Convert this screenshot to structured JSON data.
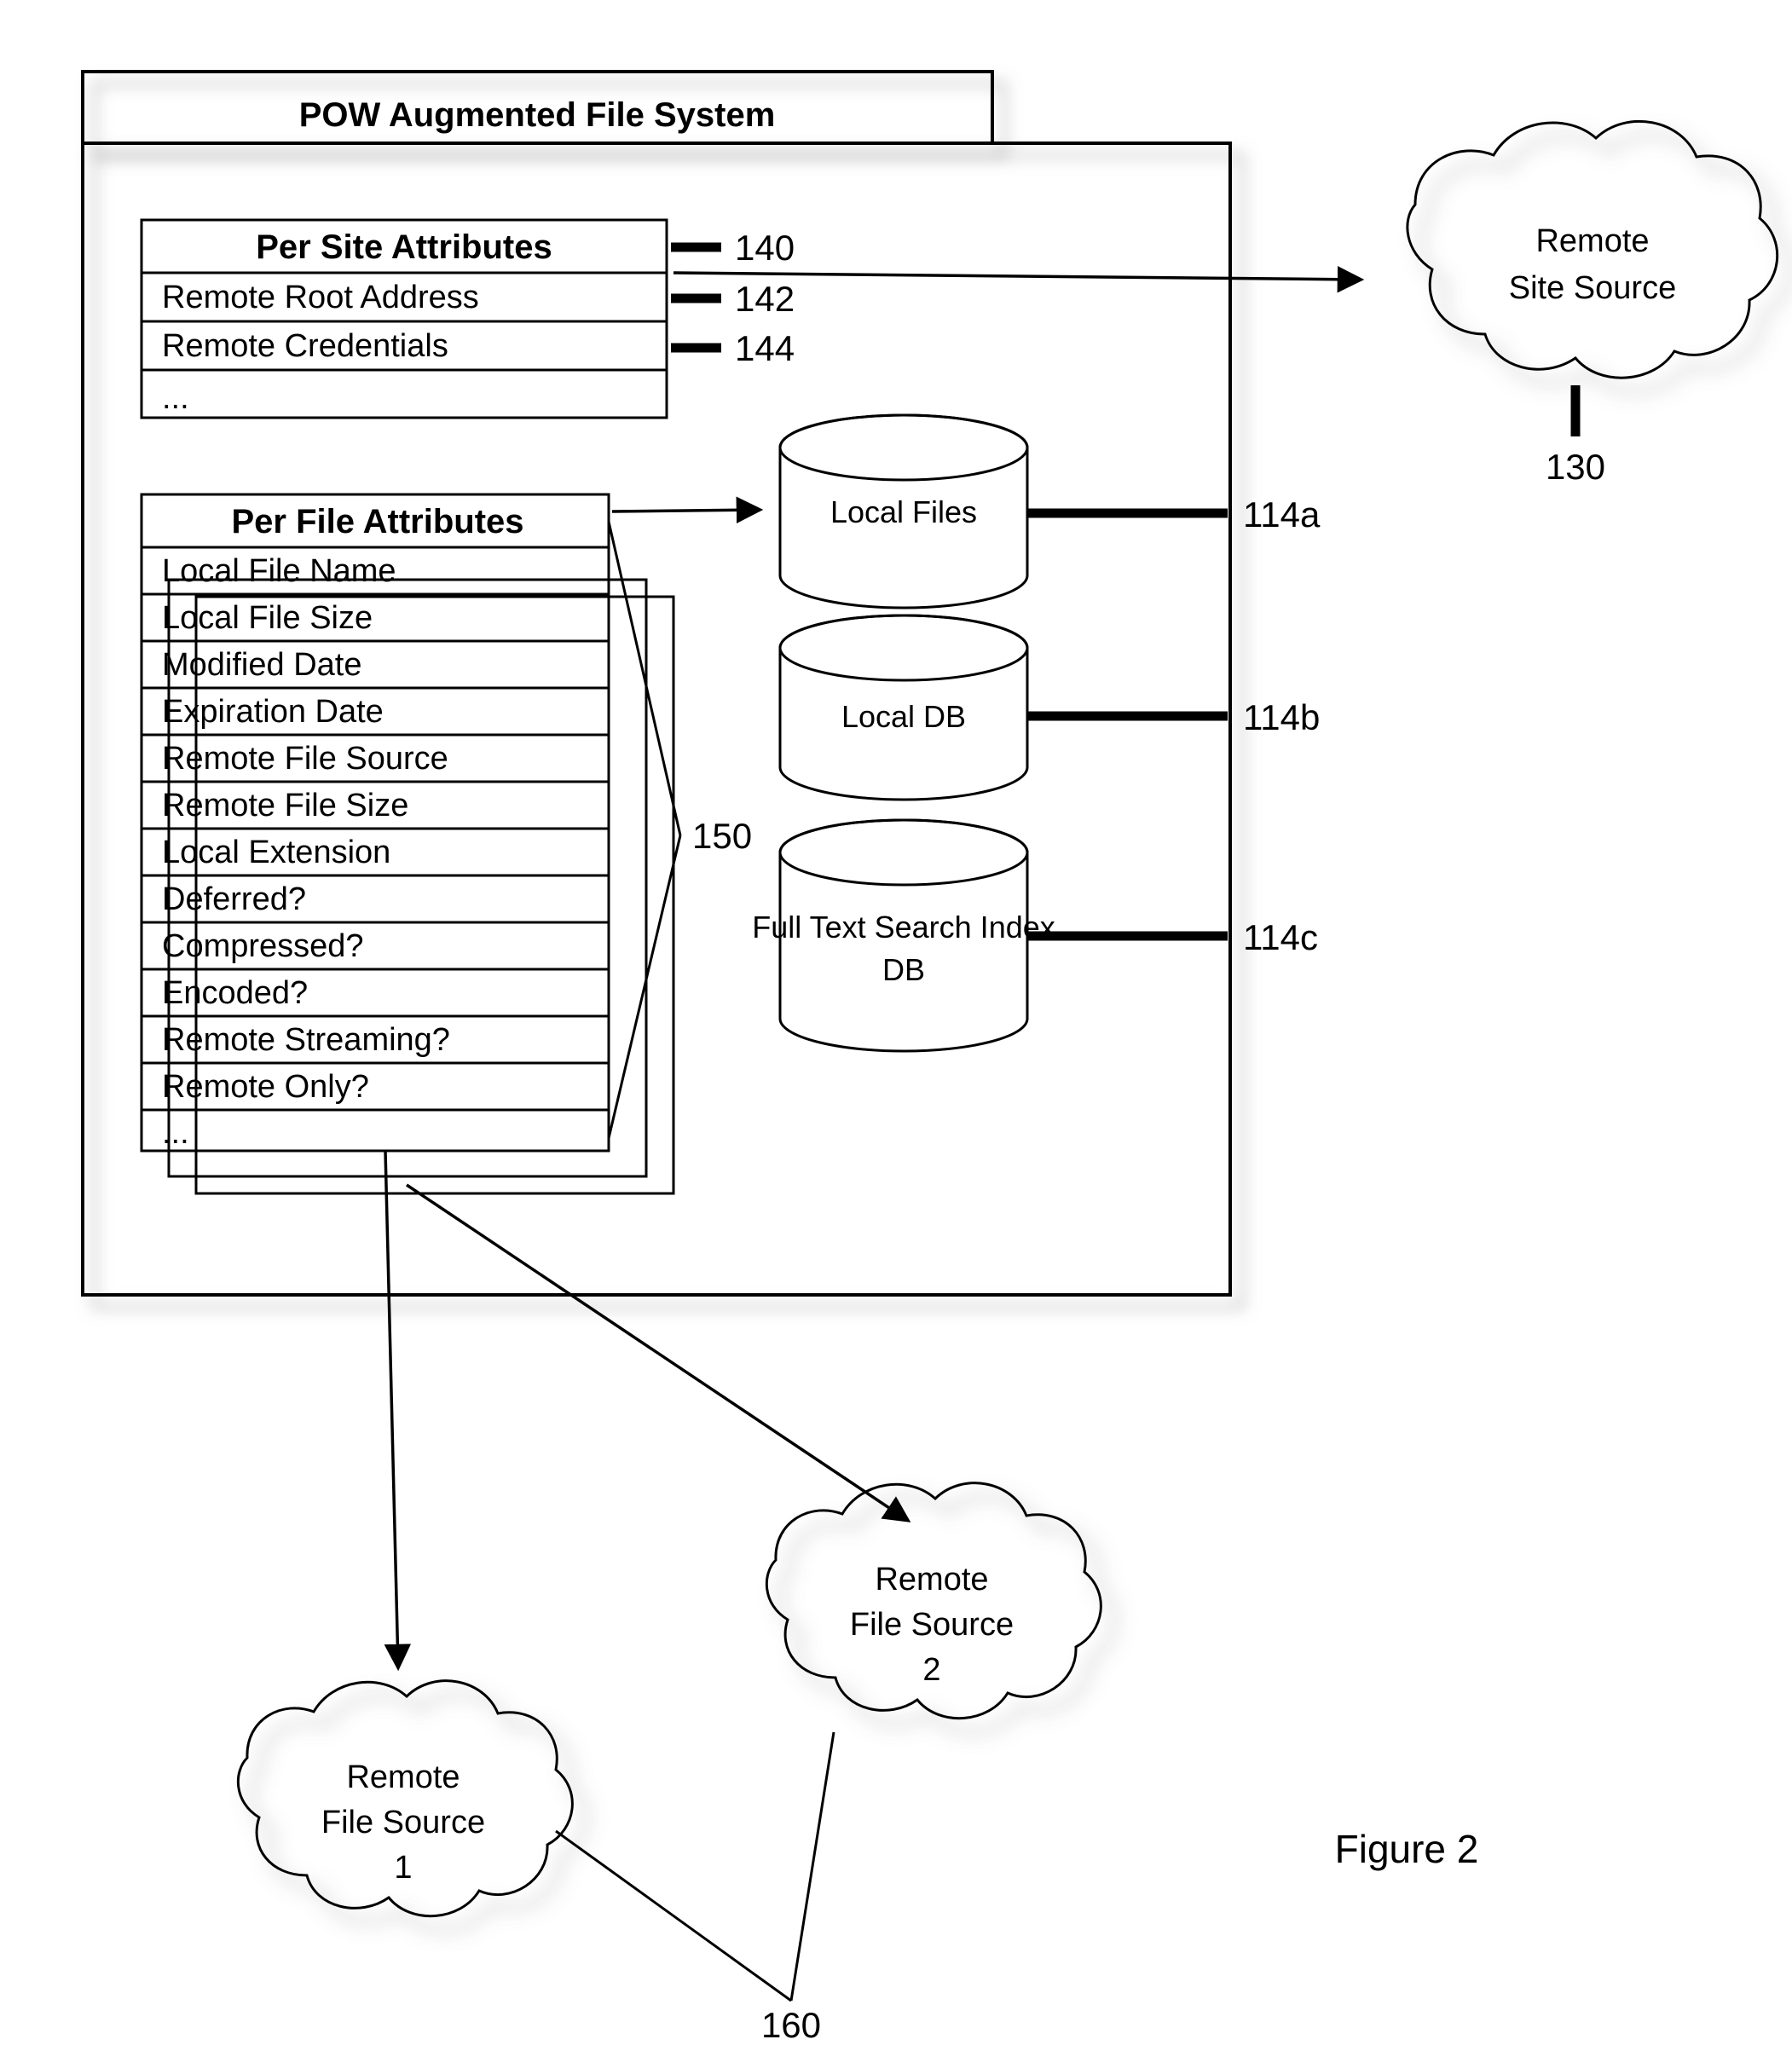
{
  "figure": {
    "caption": "Figure 2"
  },
  "container": {
    "title": "POW Augmented File System"
  },
  "per_site_attributes": {
    "header": "Per Site Attributes",
    "ref": "140",
    "rows": [
      {
        "label": "Remote Root Address",
        "ref": "142"
      },
      {
        "label": "Remote Credentials",
        "ref": "144"
      },
      {
        "label": "...",
        "ref": ""
      }
    ]
  },
  "per_file_attributes": {
    "header": "Per File Attributes",
    "ref": "150",
    "rows": [
      {
        "label": "Local File Name"
      },
      {
        "label": "Local File Size"
      },
      {
        "label": "Modified Date"
      },
      {
        "label": "Expiration Date"
      },
      {
        "label": "Remote File Source"
      },
      {
        "label": "Remote File Size"
      },
      {
        "label": "Local Extension"
      },
      {
        "label": "Deferred?"
      },
      {
        "label": "Compressed?"
      },
      {
        "label": "Encoded?"
      },
      {
        "label": "Remote Streaming?"
      },
      {
        "label": "Remote Only?"
      },
      {
        "label": "..."
      }
    ]
  },
  "stores": [
    {
      "name": "Local Files",
      "ref": "114a"
    },
    {
      "name": "Local DB",
      "ref": "114b"
    },
    {
      "name": "Full Text Search Index DB",
      "name_line1": "Full Text Search Index",
      "name_line2": "DB",
      "ref": "114c"
    }
  ],
  "clouds": [
    {
      "id": "remote-site-source",
      "line1": "Remote",
      "line2": "Site Source",
      "line3": "",
      "ref": "130"
    },
    {
      "id": "remote-file-source-2",
      "line1": "Remote",
      "line2": "File Source",
      "line3": "2",
      "ref": "160"
    },
    {
      "id": "remote-file-source-1",
      "line1": "Remote",
      "line2": "File Source",
      "line3": "1",
      "ref": "160"
    }
  ],
  "colors": {
    "stroke": "#000000",
    "fill": "#ffffff",
    "shadow": "#b4b4b4"
  }
}
